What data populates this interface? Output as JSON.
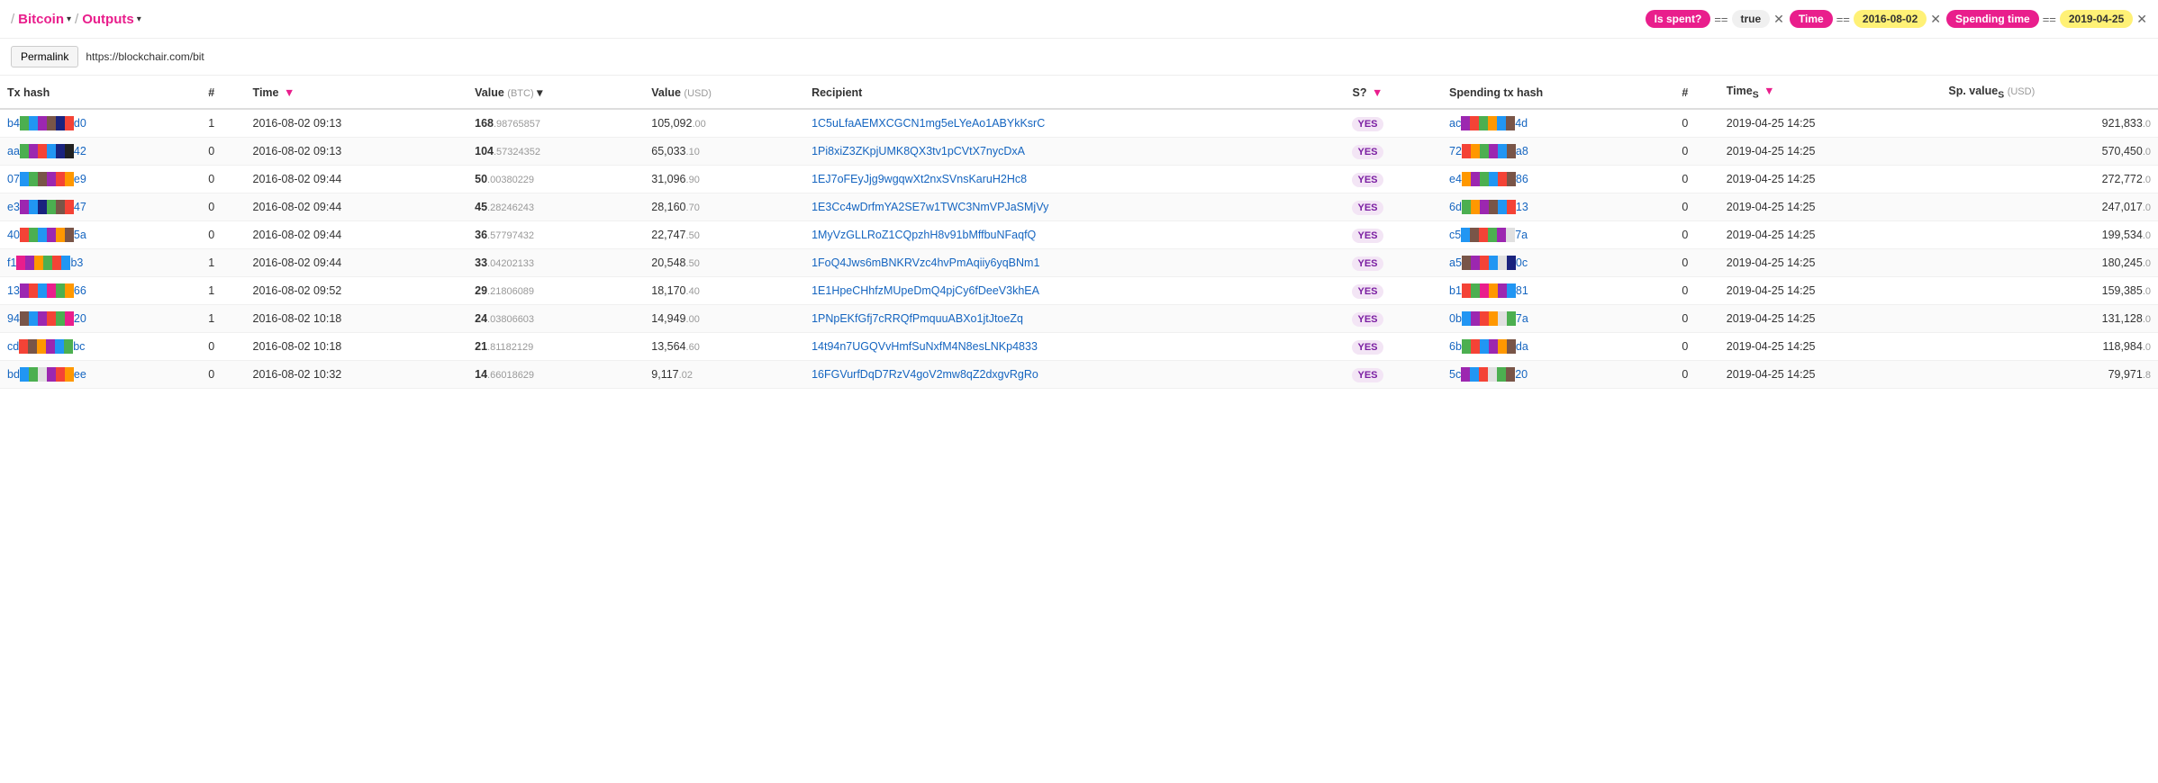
{
  "breadcrumb": {
    "items": [
      {
        "label": "Bitcoin",
        "id": "bitcoin"
      },
      {
        "label": "Outputs",
        "id": "outputs"
      }
    ]
  },
  "filters": [
    {
      "label": "Is spent?",
      "op": "==",
      "value": "true",
      "value_style": "white"
    },
    {
      "label": "Time",
      "op": "==",
      "value": "2016-08-02",
      "value_style": "yellow"
    },
    {
      "label": "Spending time",
      "op": "==",
      "value": "2019-04-25",
      "value_style": "yellow"
    }
  ],
  "permalink": {
    "button": "Permalink",
    "url": "https://blockchair.com/bit"
  },
  "table": {
    "columns": [
      {
        "id": "tx_hash",
        "label": "Tx hash"
      },
      {
        "id": "num",
        "label": "#"
      },
      {
        "id": "time",
        "label": "Time",
        "filter": true
      },
      {
        "id": "value_btc",
        "label": "Value",
        "unit": "(BTC)",
        "sort": true
      },
      {
        "id": "value_usd",
        "label": "Value",
        "unit": "(USD)"
      },
      {
        "id": "recipient",
        "label": "Recipient"
      },
      {
        "id": "spent",
        "label": "S?",
        "filter": true
      },
      {
        "id": "spending_tx",
        "label": "Spending tx hash"
      },
      {
        "id": "sp_num",
        "label": "#"
      },
      {
        "id": "time_s",
        "label": "Times",
        "filter": true
      },
      {
        "id": "sp_value",
        "label": "Sp. values",
        "unit": "(USD)"
      }
    ],
    "rows": [
      {
        "tx_hash_prefix": "b4",
        "tx_hash_suffix": "d0",
        "tx_hash_colors": [
          "#4caf50",
          "#2196f3",
          "#9c27b0",
          "#795548",
          "#1a237e",
          "#f44336"
        ],
        "num": "1",
        "time": "2016-08-02 09:13",
        "value_btc_int": "168",
        "value_btc_dec": ".98765857",
        "value_usd_int": "105,092",
        "value_usd_dec": ".00",
        "recipient": "1C5uLfaAEMXCGCN1mg5eLYeAo1ABYkKsrC",
        "spent": "YES",
        "sp_hash_prefix": "ac",
        "sp_hash_suffix": "4d",
        "sp_hash_colors": [
          "#9c27b0",
          "#f44336",
          "#4caf50",
          "#ff9800",
          "#2196f3",
          "#795548"
        ],
        "sp_num": "0",
        "sp_time": "2019-04-25 14:25",
        "sp_value_int": "921,833",
        "sp_value_dec": ".0"
      },
      {
        "tx_hash_prefix": "aa",
        "tx_hash_suffix": "42",
        "tx_hash_colors": [
          "#4caf50",
          "#9c27b0",
          "#f44336",
          "#2196f3",
          "#1a237e",
          "#212121"
        ],
        "num": "0",
        "time": "2016-08-02 09:13",
        "value_btc_int": "104",
        "value_btc_dec": ".57324352",
        "value_usd_int": "65,033",
        "value_usd_dec": ".10",
        "recipient": "1Pi8xiZ3ZKpjUMK8QX3tv1pCVtX7nycDxA",
        "spent": "YES",
        "sp_hash_prefix": "72",
        "sp_hash_suffix": "a8",
        "sp_hash_colors": [
          "#f44336",
          "#ff9800",
          "#4caf50",
          "#9c27b0",
          "#2196f3",
          "#795548"
        ],
        "sp_num": "0",
        "sp_time": "2019-04-25 14:25",
        "sp_value_int": "570,450",
        "sp_value_dec": ".0"
      },
      {
        "tx_hash_prefix": "07",
        "tx_hash_suffix": "e9",
        "tx_hash_colors": [
          "#2196f3",
          "#4caf50",
          "#795548",
          "#9c27b0",
          "#f44336",
          "#ff9800"
        ],
        "num": "0",
        "time": "2016-08-02 09:44",
        "value_btc_int": "50",
        "value_btc_dec": ".00380229",
        "value_usd_int": "31,096",
        "value_usd_dec": ".90",
        "recipient": "1EJ7oFEyJjg9wgqwXt2nxSVnsKaruH2Hc8",
        "spent": "YES",
        "sp_hash_prefix": "e4",
        "sp_hash_suffix": "86",
        "sp_hash_colors": [
          "#ff9800",
          "#9c27b0",
          "#4caf50",
          "#2196f3",
          "#f44336",
          "#795548"
        ],
        "sp_num": "0",
        "sp_time": "2019-04-25 14:25",
        "sp_value_int": "272,772",
        "sp_value_dec": ".0"
      },
      {
        "tx_hash_prefix": "e3",
        "tx_hash_suffix": "47",
        "tx_hash_colors": [
          "#9c27b0",
          "#2196f3",
          "#1a237e",
          "#4caf50",
          "#795548",
          "#f44336"
        ],
        "num": "0",
        "time": "2016-08-02 09:44",
        "value_btc_int": "45",
        "value_btc_dec": ".28246243",
        "value_usd_int": "28,160",
        "value_usd_dec": ".70",
        "recipient": "1E3Cc4wDrfmYA2SE7w1TWC3NmVPJaSMjVy",
        "spent": "YES",
        "sp_hash_prefix": "6d",
        "sp_hash_suffix": "13",
        "sp_hash_colors": [
          "#4caf50",
          "#ff9800",
          "#9c27b0",
          "#795548",
          "#2196f3",
          "#f44336"
        ],
        "sp_num": "0",
        "sp_time": "2019-04-25 14:25",
        "sp_value_int": "247,017",
        "sp_value_dec": ".0"
      },
      {
        "tx_hash_prefix": "40",
        "tx_hash_suffix": "5a",
        "tx_hash_colors": [
          "#f44336",
          "#4caf50",
          "#2196f3",
          "#9c27b0",
          "#ff9800",
          "#795548"
        ],
        "num": "0",
        "time": "2016-08-02 09:44",
        "value_btc_int": "36",
        "value_btc_dec": ".57797432",
        "value_usd_int": "22,747",
        "value_usd_dec": ".50",
        "recipient": "1MyVzGLLRoZ1CQpzhH8v91bMffbuNFaqfQ",
        "spent": "YES",
        "sp_hash_prefix": "c5",
        "sp_hash_suffix": "7a",
        "sp_hash_colors": [
          "#2196f3",
          "#795548",
          "#f44336",
          "#4caf50",
          "#9c27b0",
          "#e0e0e0"
        ],
        "sp_num": "0",
        "sp_time": "2019-04-25 14:25",
        "sp_value_int": "199,534",
        "sp_value_dec": ".0"
      },
      {
        "tx_hash_prefix": "f1",
        "tx_hash_suffix": "b3",
        "tx_hash_colors": [
          "#e91e8c",
          "#9c27b0",
          "#ff9800",
          "#4caf50",
          "#f44336",
          "#2196f3"
        ],
        "num": "1",
        "time": "2016-08-02 09:44",
        "value_btc_int": "33",
        "value_btc_dec": ".04202133",
        "value_usd_int": "20,548",
        "value_usd_dec": ".50",
        "recipient": "1FoQ4Jws6mBNKRVzc4hvPmAqiiy6yqBNm1",
        "spent": "YES",
        "sp_hash_prefix": "a5",
        "sp_hash_suffix": "0c",
        "sp_hash_colors": [
          "#795548",
          "#9c27b0",
          "#f44336",
          "#2196f3",
          "#e0e0e0",
          "#1a237e"
        ],
        "sp_num": "0",
        "sp_time": "2019-04-25 14:25",
        "sp_value_int": "180,245",
        "sp_value_dec": ".0"
      },
      {
        "tx_hash_prefix": "13",
        "tx_hash_suffix": "66",
        "tx_hash_colors": [
          "#9c27b0",
          "#f44336",
          "#2196f3",
          "#e91e8c",
          "#4caf50",
          "#ff9800"
        ],
        "num": "1",
        "time": "2016-08-02 09:52",
        "value_btc_int": "29",
        "value_btc_dec": ".21806089",
        "value_usd_int": "18,170",
        "value_usd_dec": ".40",
        "recipient": "1E1HpeCHhfzMUpeDmQ4pjCy6fDeeV3khEA",
        "spent": "YES",
        "sp_hash_prefix": "b1",
        "sp_hash_suffix": "81",
        "sp_hash_colors": [
          "#f44336",
          "#4caf50",
          "#e91e8c",
          "#ff9800",
          "#9c27b0",
          "#2196f3"
        ],
        "sp_num": "0",
        "sp_time": "2019-04-25 14:25",
        "sp_value_int": "159,385",
        "sp_value_dec": ".0"
      },
      {
        "tx_hash_prefix": "94",
        "tx_hash_suffix": "20",
        "tx_hash_colors": [
          "#795548",
          "#2196f3",
          "#9c27b0",
          "#f44336",
          "#4caf50",
          "#e91e8c"
        ],
        "num": "1",
        "time": "2016-08-02 10:18",
        "value_btc_int": "24",
        "value_btc_dec": ".03806603",
        "value_usd_int": "14,949",
        "value_usd_dec": ".00",
        "recipient": "1PNpEKfGfj7cRRQfPmquuABXo1jtJtoeZq",
        "spent": "YES",
        "sp_hash_prefix": "0b",
        "sp_hash_suffix": "7a",
        "sp_hash_colors": [
          "#2196f3",
          "#9c27b0",
          "#f44336",
          "#ff9800",
          "#e0e0e0",
          "#4caf50"
        ],
        "sp_num": "0",
        "sp_time": "2019-04-25 14:25",
        "sp_value_int": "131,128",
        "sp_value_dec": ".0"
      },
      {
        "tx_hash_prefix": "cd",
        "tx_hash_suffix": "bc",
        "tx_hash_colors": [
          "#f44336",
          "#795548",
          "#ff9800",
          "#9c27b0",
          "#2196f3",
          "#4caf50"
        ],
        "num": "0",
        "time": "2016-08-02 10:18",
        "value_btc_int": "21",
        "value_btc_dec": ".81182129",
        "value_usd_int": "13,564",
        "value_usd_dec": ".60",
        "recipient": "14t94n7UGQVvHmfSuNxfM4N8esLNKp4833",
        "spent": "YES",
        "sp_hash_prefix": "6b",
        "sp_hash_suffix": "da",
        "sp_hash_colors": [
          "#4caf50",
          "#f44336",
          "#2196f3",
          "#9c27b0",
          "#ff9800",
          "#795548"
        ],
        "sp_num": "0",
        "sp_time": "2019-04-25 14:25",
        "sp_value_int": "118,984",
        "sp_value_dec": ".0"
      },
      {
        "tx_hash_prefix": "bd",
        "tx_hash_suffix": "ee",
        "tx_hash_colors": [
          "#2196f3",
          "#4caf50",
          "#e0e0e0",
          "#9c27b0",
          "#f44336",
          "#ff9800"
        ],
        "num": "0",
        "time": "2016-08-02 10:32",
        "value_btc_int": "14",
        "value_btc_dec": ".66018629",
        "value_usd_int": "9,117",
        "value_usd_dec": ".02",
        "recipient": "16FGVurfDqD7RzV4goV2mw8qZ2dxgvRgRo",
        "spent": "YES",
        "sp_hash_prefix": "5c",
        "sp_hash_suffix": "20",
        "sp_hash_colors": [
          "#9c27b0",
          "#2196f3",
          "#f44336",
          "#e0e0e0",
          "#4caf50",
          "#795548"
        ],
        "sp_num": "0",
        "sp_time": "2019-04-25 14:25",
        "sp_value_int": "79,971",
        "sp_value_dec": ".8"
      }
    ]
  }
}
